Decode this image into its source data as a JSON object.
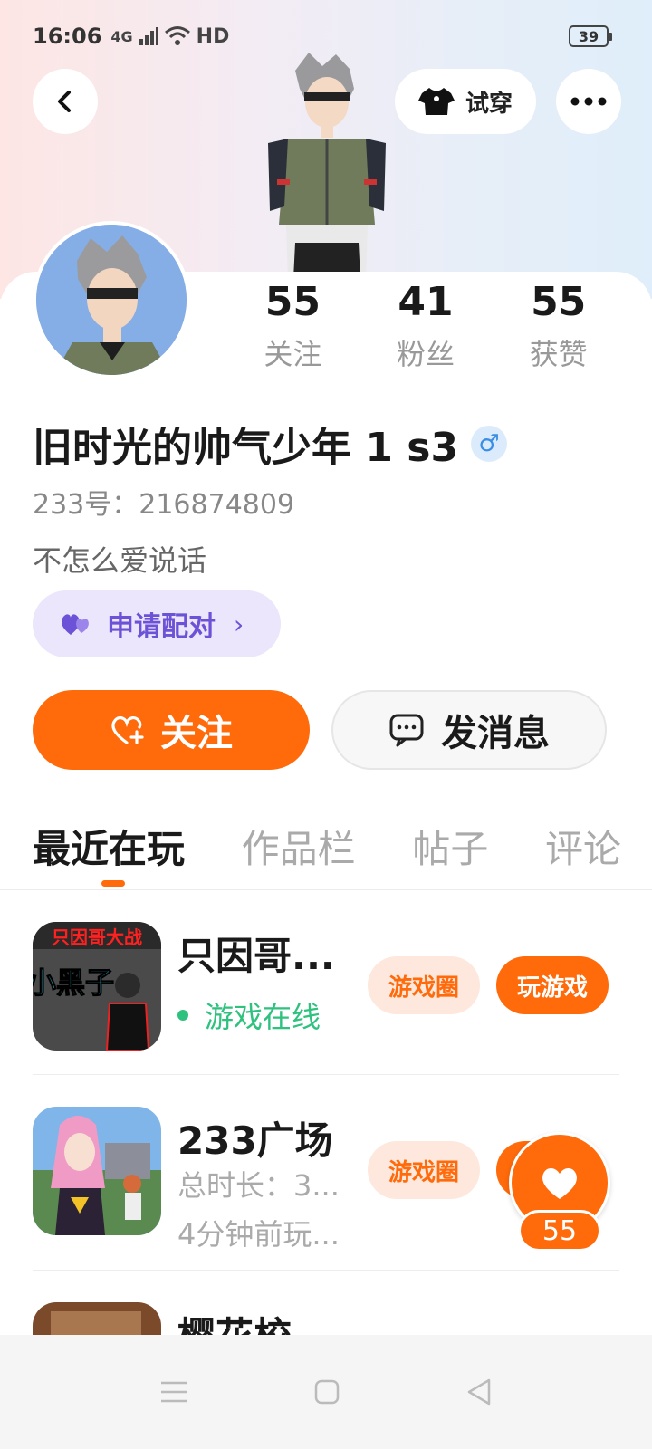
{
  "status_bar": {
    "time": "16:06",
    "network": "4G",
    "hd": "HD",
    "battery": "39"
  },
  "header": {
    "tryon_label": "试穿"
  },
  "profile": {
    "username": "旧时光的帅气少年 1 s3",
    "gender_symbol": "♂",
    "user_id": "233号：216874809",
    "bio": "不怎么爱说话",
    "pair_label": "申请配对"
  },
  "stats": [
    {
      "value": "55",
      "label": "关注"
    },
    {
      "value": "41",
      "label": "粉丝"
    },
    {
      "value": "55",
      "label": "获赞"
    }
  ],
  "actions": {
    "follow_label": "关注",
    "message_label": "发消息"
  },
  "tabs": [
    "最近在玩",
    "作品栏",
    "帖子",
    "评论"
  ],
  "games": [
    {
      "name": "只因哥...",
      "icon_text_top": "只因哥大战",
      "icon_text_main": "小黑子",
      "status": "游戏在线",
      "circle_label": "游戏圈",
      "play_label": "玩游戏"
    },
    {
      "name": "233广场",
      "duration": "总时长：3...",
      "last_played": "4分钟前玩...",
      "circle_label": "游戏圈"
    },
    {
      "name": "樱花校..."
    }
  ],
  "like_float": {
    "count": "55"
  },
  "colors": {
    "accent": "#ff6a0a",
    "purple": "#6c52d6",
    "online": "#2ec27e"
  }
}
